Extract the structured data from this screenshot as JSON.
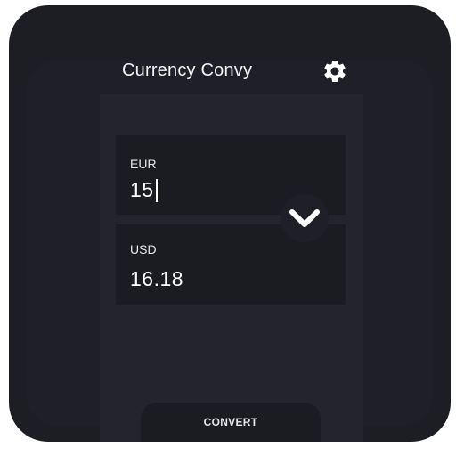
{
  "app": {
    "title": "Currency Convy"
  },
  "icons": {
    "settings": "gear-icon",
    "swap": "chevron-down-icon"
  },
  "from_card": {
    "currency": "EUR",
    "amount": "15"
  },
  "to_card": {
    "currency": "USD",
    "amount": "16.18"
  },
  "actions": {
    "convert_label": "CONVERT"
  },
  "colors": {
    "background": "#1d1e24",
    "card": "#1b1c22",
    "text": "#ffffff"
  }
}
